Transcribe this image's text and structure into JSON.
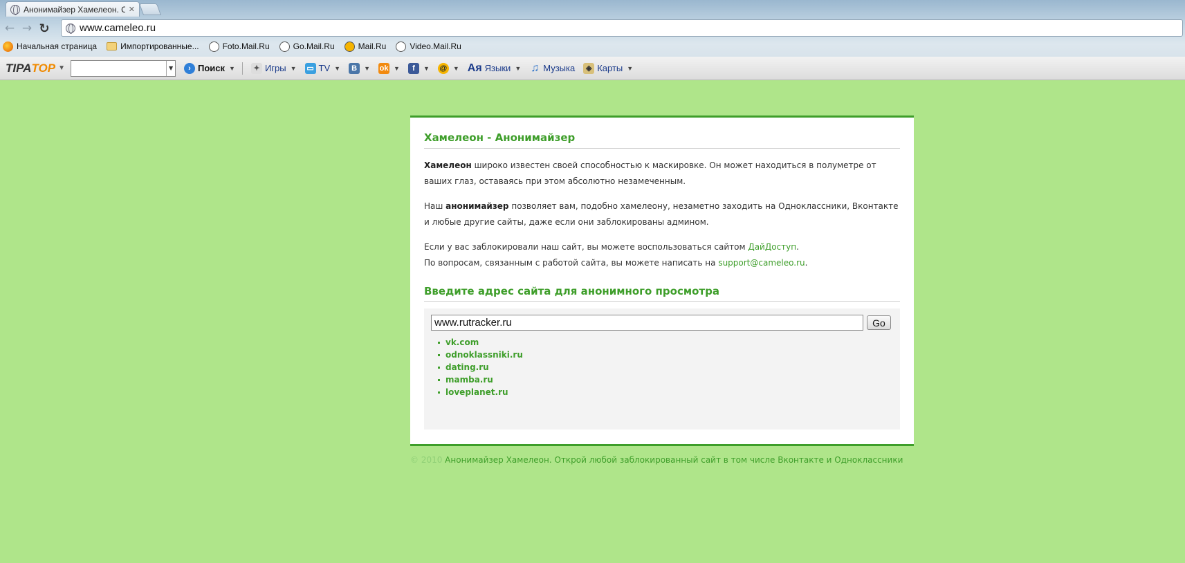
{
  "browser": {
    "tab_title": "Анонимайзер Хамелеон. С",
    "tab_close": "✕",
    "url": "www.cameleo.ru"
  },
  "bookmarks": [
    {
      "label": "Начальная страница",
      "icon": "firefox-icon"
    },
    {
      "label": "Импортированные...",
      "icon": "folder-icon"
    },
    {
      "label": "Foto.Mail.Ru",
      "icon": "globe-icon"
    },
    {
      "label": "Go.Mail.Ru",
      "icon": "globe-icon"
    },
    {
      "label": "Mail.Ru",
      "icon": "mailru-icon"
    },
    {
      "label": "Video.Mail.Ru",
      "icon": "globe-icon"
    }
  ],
  "toolbar": {
    "logo_part1": "TIPA",
    "logo_part2": "TOP",
    "search_label": "Поиск",
    "games_label": "Игры",
    "tv_label": "TV",
    "vk_glyph": "B",
    "ok_glyph": "ok",
    "fb_glyph": "f",
    "mail_glyph": "@",
    "lang_glyph": "Ая",
    "lang_label": "Языки",
    "music_label": "Музыка",
    "maps_label": "Карты"
  },
  "page": {
    "heading": "Хамелеон - Анонимайзер",
    "p1_bold": "Хамелеон",
    "p1_rest": " широко известен своей способностью к маскировке. Он может находиться в полуметре от ваших глаз, оставаясь при этом абсолютно незамеченным.",
    "p2_start": "Наш ",
    "p2_bold": "анонимайзер",
    "p2_rest": " позволяет вам, подобно хамелеону, незаметно заходить на Одноклассники, Вконтакте и любые другие сайты, даже если они заблокированы админом.",
    "p3_start": "Если у вас заблокировали наш сайт, вы можете воспользоваться сайтом ",
    "p3_link": "ДайДоступ",
    "p3_end": ".",
    "p4_start": "По вопросам, связанным с работой сайта, вы можете написать на ",
    "p4_link": "support@cameleo.ru",
    "p4_end": ".",
    "form_heading": "Введите адрес сайта для анонимного просмотра",
    "input_value": "www.rutracker.ru",
    "go_label": "Go",
    "sites": [
      "vk.com",
      "odnoklassniki.ru",
      "dating.ru",
      "mamba.ru",
      "loveplanet.ru"
    ],
    "footer_copy": "© 2010",
    "footer_text": " Анонимайзер Хамелеон. Открой любой заблокированный сайт в том числе Вконтакте и Одноклассники"
  },
  "colors": {
    "background": "#afe58a",
    "accent": "#3e9e2a"
  }
}
